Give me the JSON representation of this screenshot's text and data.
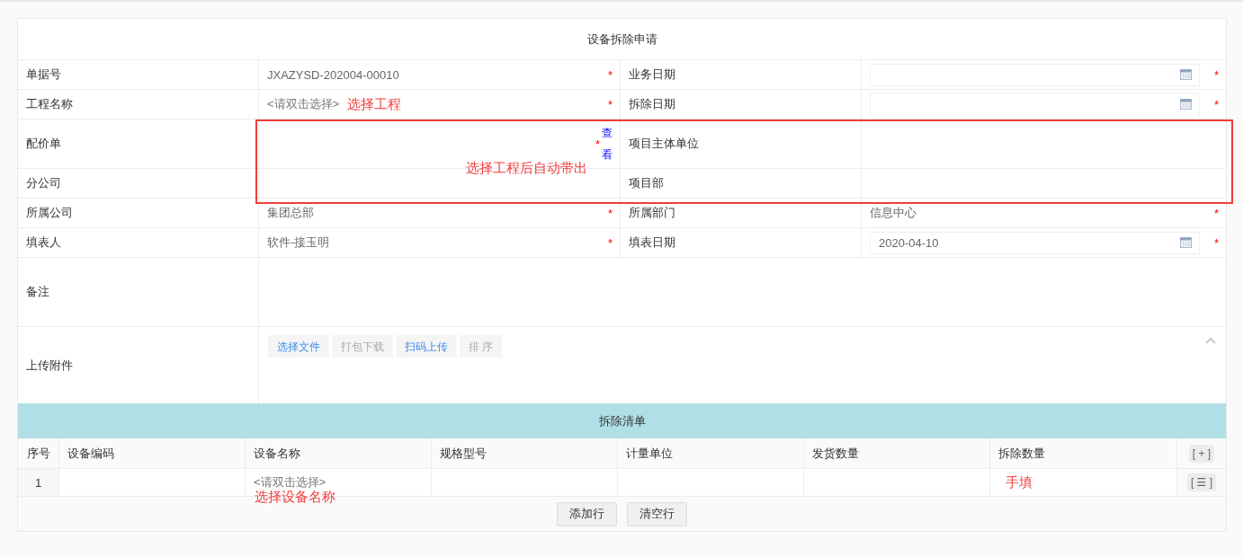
{
  "form_title": "设备拆除申请",
  "required_mark": "*",
  "rows": [
    [
      {
        "label": "单据号",
        "kind": "text",
        "value": "JXAZYSD-202004-00010",
        "required": true
      },
      {
        "label": "业务日期",
        "kind": "date",
        "required": true
      }
    ],
    [
      {
        "label": "工程名称",
        "kind": "select",
        "placeholder": "<请双击选择>",
        "annotation": "选择工程",
        "required": true
      },
      {
        "label": "拆除日期",
        "kind": "date",
        "required": true
      }
    ],
    [
      {
        "label": "配价单",
        "kind": "link",
        "link": "查看",
        "required": true
      },
      {
        "label": "项目主体单位",
        "kind": "text",
        "required": false
      }
    ],
    [
      {
        "label": "分公司",
        "kind": "text",
        "required": false
      },
      {
        "label": "项目部",
        "kind": "text",
        "required": false
      }
    ],
    [
      {
        "label": "所属公司",
        "kind": "text",
        "value": "集团总部",
        "required": true
      },
      {
        "label": "所属部门",
        "kind": "text",
        "value": "信息中心",
        "required": true
      }
    ],
    [
      {
        "label": "填表人",
        "kind": "text",
        "value": "软件-接玉明",
        "required": true
      },
      {
        "label": "填表日期",
        "kind": "date",
        "value": "2020-04-10",
        "required": true
      }
    ]
  ],
  "callout": {
    "text": "选择工程后自动带出"
  },
  "note": {
    "label": "备注"
  },
  "attachments": {
    "label": "上传附件",
    "expanded": true,
    "buttons": [
      {
        "label": "选择文件",
        "disabled": false
      },
      {
        "label": "打包下载",
        "disabled": true
      },
      {
        "label": "扫码上传",
        "disabled": false
      },
      {
        "label": "排 序",
        "disabled": true
      }
    ]
  },
  "detail": {
    "title": "拆除清单",
    "columns": [
      "序号",
      "设备编码",
      "设备名称",
      "规格型号",
      "计量单位",
      "发货数量",
      "拆除数量"
    ],
    "add_button": "[ + ]",
    "rows": [
      {
        "cells": [
          {
            "text": "1"
          },
          {},
          {
            "placeholder": "<请双击选择>",
            "annotation": "选择设备名称"
          },
          {},
          {},
          {},
          {
            "annotation": "手填"
          }
        ],
        "action": "[ ☰ ]"
      }
    ],
    "buttons": [
      "添加行",
      "清空行"
    ]
  }
}
